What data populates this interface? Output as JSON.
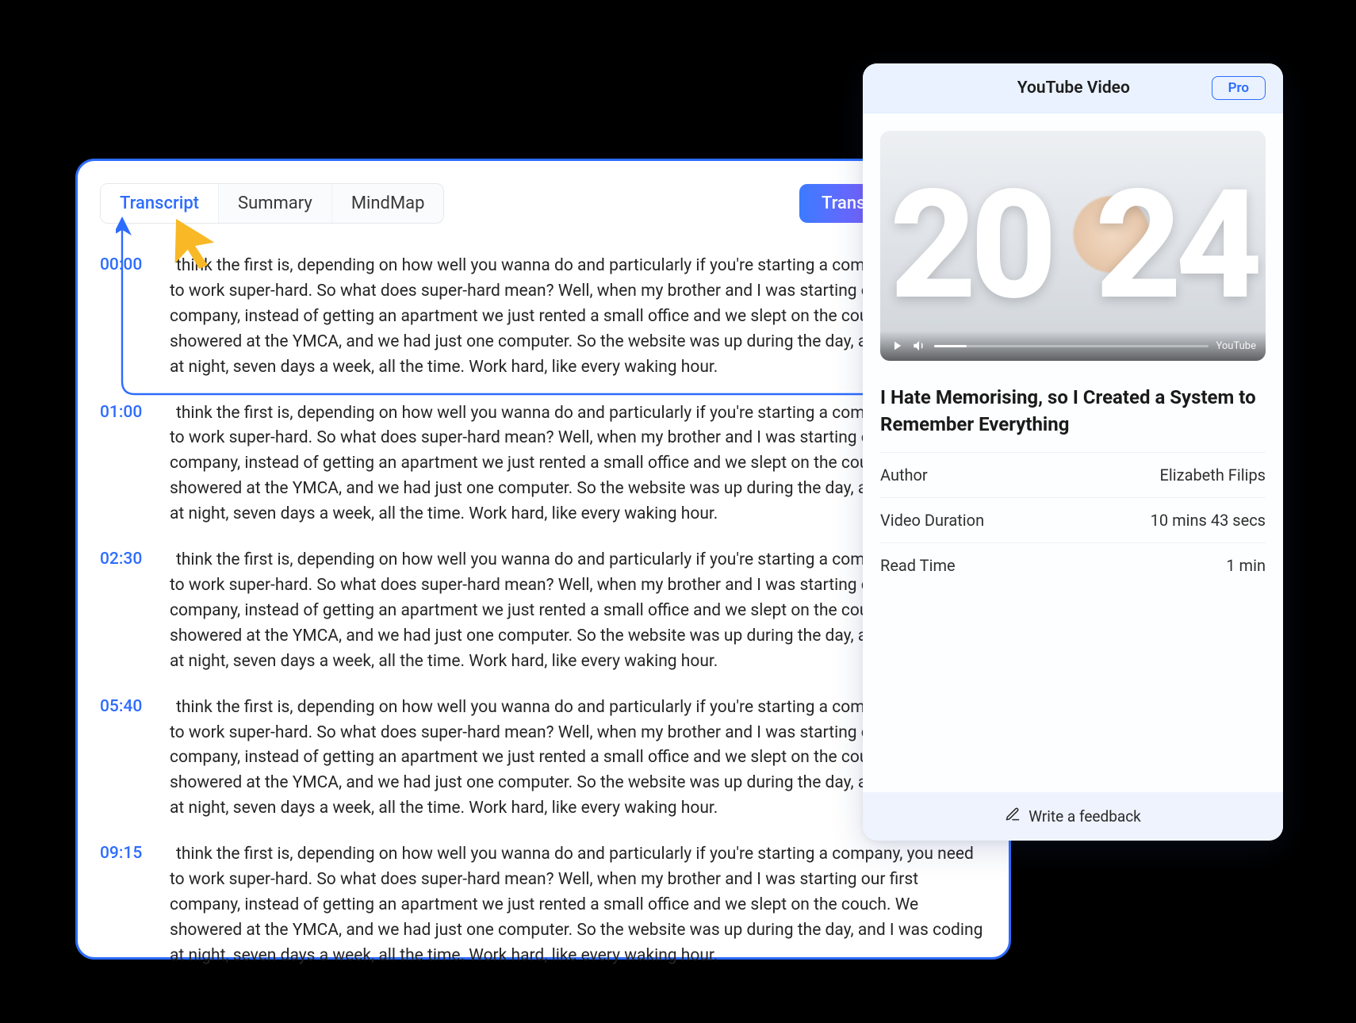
{
  "tabs": {
    "transcript": "Transcript",
    "summary": "Summary",
    "mindmap": "MindMap"
  },
  "translate_button": "Translate",
  "transcript": [
    {
      "time": "00:00",
      "text": "think the first is, depending on how well you wanna do and particularly if you're starting a company, you need to work super-hard. So what does super-hard mean? Well, when my brother and I was starting our first company, instead of getting an apartment we just rented a small office and we slept on the couch. We showered at the YMCA, and we had just one computer. So the website was up during the day, and I was coding at night, seven days a week, all the time. Work hard, like every waking hour."
    },
    {
      "time": "01:00",
      "text": "think the first is, depending on how well you wanna do and particularly if you're starting a company, you need to work super-hard. So what does super-hard mean? Well, when my brother and I was starting our first company, instead of getting an apartment we just rented a small office and we slept on the couch. We showered at the YMCA, and we had just one computer. So the website was up during the day, and I was coding at night, seven days a week, all the time. Work hard, like every waking hour."
    },
    {
      "time": "02:30",
      "text": "think the first is, depending on how well you wanna do and particularly if you're starting a company, you need to work super-hard. So what does super-hard mean? Well, when my brother and I was starting our first company, instead of getting an apartment we just rented a small office and we slept on the couch. We showered at the YMCA, and we had just one computer. So the website was up during the day, and I was coding at night, seven days a week, all the time. Work hard, like every waking hour."
    },
    {
      "time": "05:40",
      "text": "think the first is, depending on how well you wanna do and particularly if you're starting a company, you need to work super-hard. So what does super-hard mean? Well, when my brother and I was starting our first company, instead of getting an apartment we just rented a small office and we slept on the couch. We showered at the YMCA, and we had just one computer. So the website was up during the day, and I was coding at night, seven days a week, all the time. Work hard, like every waking hour."
    },
    {
      "time": "09:15",
      "text": "think the first is, depending on how well you wanna do and particularly if you're starting a company, you need to work super-hard. So what does super-hard mean? Well, when my brother and I was starting our first company, instead of getting an apartment we just rented a small office and we slept on the couch. We showered at the YMCA, and we had just one computer. So the website was up during the day, and I was coding at night, seven days a week, all the time. Work hard, like every waking hour."
    }
  ],
  "side_panel": {
    "header_title": "YouTube Video",
    "pro_label": "Pro",
    "thumb_year_left": "20",
    "thumb_year_right": "24",
    "youtube_tag": "YouTube",
    "video_title": "I Hate Memorising, so I Created a System to Remember Everything",
    "meta": [
      {
        "label": "Author",
        "value": "Elizabeth Filips"
      },
      {
        "label": "Video Duration",
        "value": "10 mins 43 secs"
      },
      {
        "label": "Read Time",
        "value": "1 min"
      }
    ],
    "feedback_label": "Write a feedback"
  }
}
